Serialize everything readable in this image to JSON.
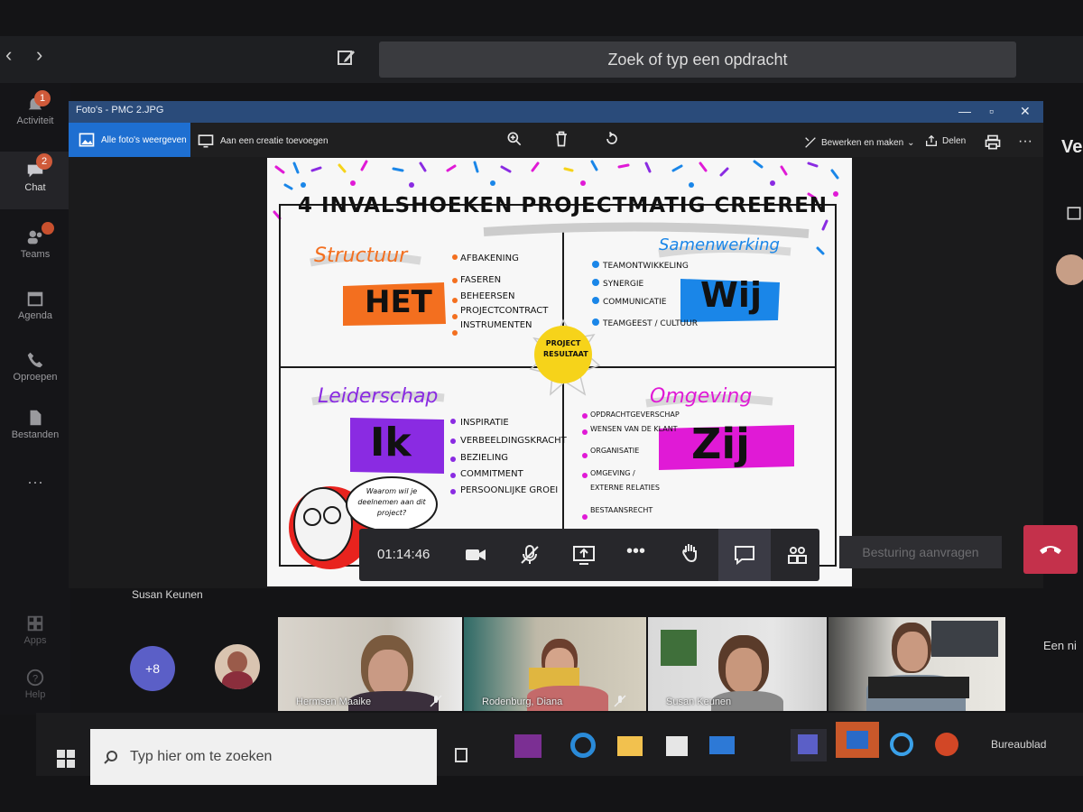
{
  "teams": {
    "search_placeholder": "Zoek of typ een opdracht",
    "rail": [
      {
        "label": "Activiteit",
        "badge": "1"
      },
      {
        "label": "Chat",
        "badge": "2"
      },
      {
        "label": "Teams",
        "badge": ""
      },
      {
        "label": "Agenda",
        "badge": ""
      },
      {
        "label": "Oproepen",
        "badge": ""
      },
      {
        "label": "Bestanden",
        "badge": ""
      },
      {
        "label": "Apps",
        "badge": ""
      },
      {
        "label": "Help",
        "badge": ""
      }
    ],
    "right_header": "Ve",
    "right_text": "Een ni"
  },
  "photos": {
    "title": "Foto's - PMC 2.JPG",
    "all_photos": "Alle foto's weergeven",
    "add_to_creation": "Aan een creatie toevoegen",
    "edit_create": "Bewerken en maken",
    "share": "Delen"
  },
  "sketch": {
    "title": "4 INVALSHOEKEN PROJECTMATIG CREEREN",
    "q1": {
      "heading": "Structuur",
      "word": "HET",
      "bullets": [
        "AFBAKENING",
        "FASEREN",
        "BEHEERSEN",
        "PROJECTCONTRACT",
        "INSTRUMENTEN"
      ]
    },
    "q2": {
      "heading": "Samenwerking",
      "word": "Wij",
      "bullets": [
        "TEAMONTWIKKELING",
        "SYNERGIE",
        "COMMUNICATIE",
        "TEAMGEEST / CULTUUR"
      ]
    },
    "q3": {
      "heading": "Leiderschap",
      "word": "Ik",
      "bullets": [
        "INSPIRATIE",
        "VERBEELDINGSKRACHT",
        "BEZIELING",
        "COMMITMENT",
        "PERSOONLIJKE GROEI"
      ]
    },
    "q4": {
      "heading": "Omgeving",
      "word": "Zij",
      "bullets": [
        "OPDRACHTGEVERSCHAP",
        "WENSEN VAN DE KLANT",
        "ORGANISATIE",
        "OMGEVING / EXTERNE RELATIES",
        "BESTAANSRECHT"
      ]
    },
    "center": "PROJECT RESULTAAT",
    "speech": "Waarom wil je deelnemen aan dit project?"
  },
  "call": {
    "timer": "01:14:46",
    "request_control": "Besturing aanvragen",
    "presenter": "Susan Keunen",
    "more_count": "+8",
    "tiles": [
      {
        "name": "Hermsen Maaike"
      },
      {
        "name": "Rodenburg, Diana"
      },
      {
        "name": "Susan Keunen"
      },
      {
        "name": ""
      }
    ]
  },
  "taskbar": {
    "search": "Typ hier om te zoeken",
    "desktop": "Bureaublad"
  },
  "colors": {
    "teams_purple": "#5b5fc7",
    "hangup": "#c4314b",
    "photos_blue": "#1e6fd1",
    "orange": "#f36f1f",
    "blue": "#1a86e8",
    "purple": "#8a2be2",
    "magenta": "#e01ad6",
    "yellow": "#f6d31a"
  }
}
